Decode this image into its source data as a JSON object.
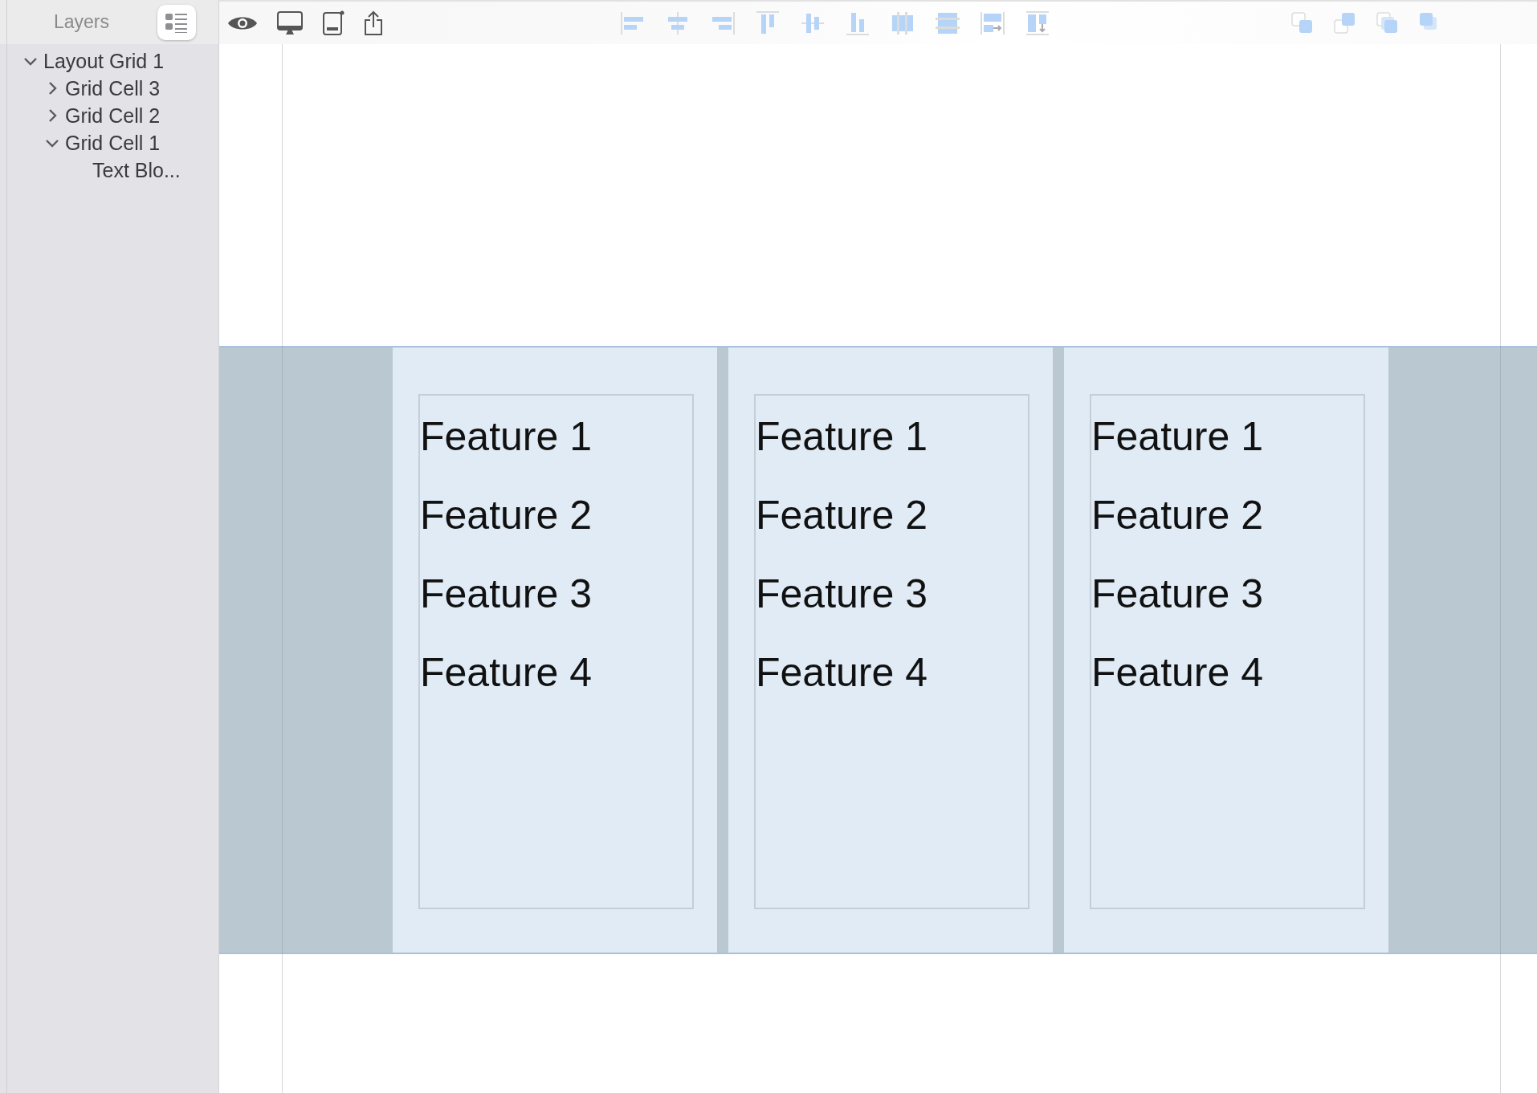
{
  "sidebar": {
    "title": "Layers",
    "tree": [
      {
        "label": "Layout Grid 1",
        "expanded": true,
        "children": [
          {
            "label": "Grid Cell 3",
            "expanded": false
          },
          {
            "label": "Grid Cell 2",
            "expanded": false
          },
          {
            "label": "Grid Cell 1",
            "expanded": true,
            "children": [
              {
                "label": "Text Blo..."
              }
            ]
          }
        ]
      }
    ]
  },
  "grid": {
    "cells": [
      {
        "features": [
          "Feature 1",
          "Feature 2",
          "Feature 3",
          "Feature 4"
        ]
      },
      {
        "features": [
          "Feature 1",
          "Feature 2",
          "Feature 3",
          "Feature 4"
        ]
      },
      {
        "features": [
          "Feature 1",
          "Feature 2",
          "Feature 3",
          "Feature 4"
        ]
      }
    ]
  }
}
